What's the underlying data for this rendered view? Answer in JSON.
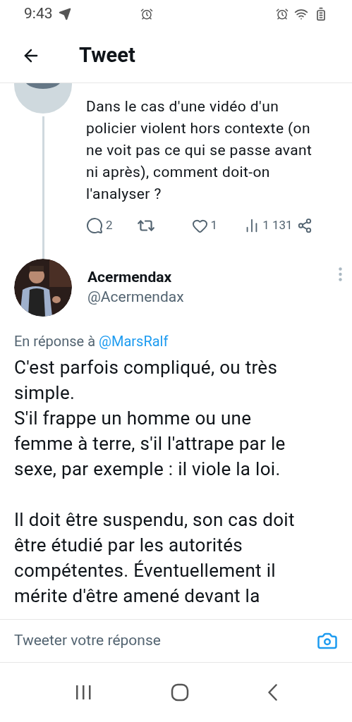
{
  "status_bar": {
    "time": "9:43"
  },
  "header": {
    "title": "Tweet"
  },
  "parent_tweet": {
    "text": "Dans le cas d'une vidéo d'un policier violent hors contexte (on ne voit pas ce qui se passe avant ni après), comment doit-on l'analyser ?",
    "replies": "2",
    "likes": "1",
    "views": "1 131"
  },
  "tweet": {
    "name": "Acermendax",
    "handle": "@Acermendax",
    "reply_prefix": "En réponse à",
    "reply_to": "@MarsRalf",
    "blocks": [
      [
        "C'est parfois compliqué, ou très simple.",
        "S'il frappe un homme ou une femme à terre, s'il l'attrape par le sexe, par exemple : il viole la loi."
      ],
      [
        "Il doit être suspendu, son cas doit être étudié par les autorités compétentes. Éventuellement il mérite d'être amené devant la"
      ]
    ]
  },
  "reply_bar": {
    "placeholder": "Tweeter votre réponse"
  }
}
